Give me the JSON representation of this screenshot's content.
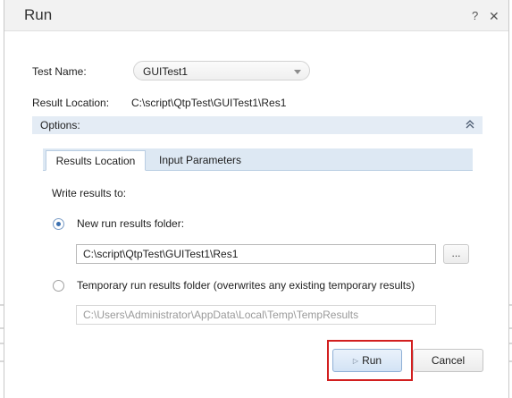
{
  "dialog": {
    "title": "Run",
    "help_glyph": "?",
    "close_glyph": "✕"
  },
  "form": {
    "test_name_label": "Test Name:",
    "test_name_value": "GUITest1",
    "result_location_label": "Result Location:",
    "result_location_value": "C:\\script\\QtpTest\\GUITest1\\Res1"
  },
  "options": {
    "label": "Options:",
    "collapse_icon": "double-chevron-up-icon"
  },
  "tabs": [
    {
      "label": "Results Location",
      "active": true
    },
    {
      "label": "Input Parameters",
      "active": false
    }
  ],
  "results": {
    "write_label": "Write results to:",
    "new_folder_label": "New run results folder:",
    "new_folder_selected": true,
    "new_folder_path": "C:\\script\\QtpTest\\GUITest1\\Res1",
    "browse_label": "...",
    "temp_folder_label": "Temporary run results folder (overwrites any existing temporary results)",
    "temp_folder_selected": false,
    "temp_folder_path": "C:\\Users\\Administrator\\AppData\\Local\\Temp\\TempResults"
  },
  "buttons": {
    "run_label": "Run",
    "run_icon": "play-icon",
    "cancel_label": "Cancel"
  },
  "colors": {
    "highlight": "#d21f1f",
    "accent": "#3a6fb0"
  }
}
